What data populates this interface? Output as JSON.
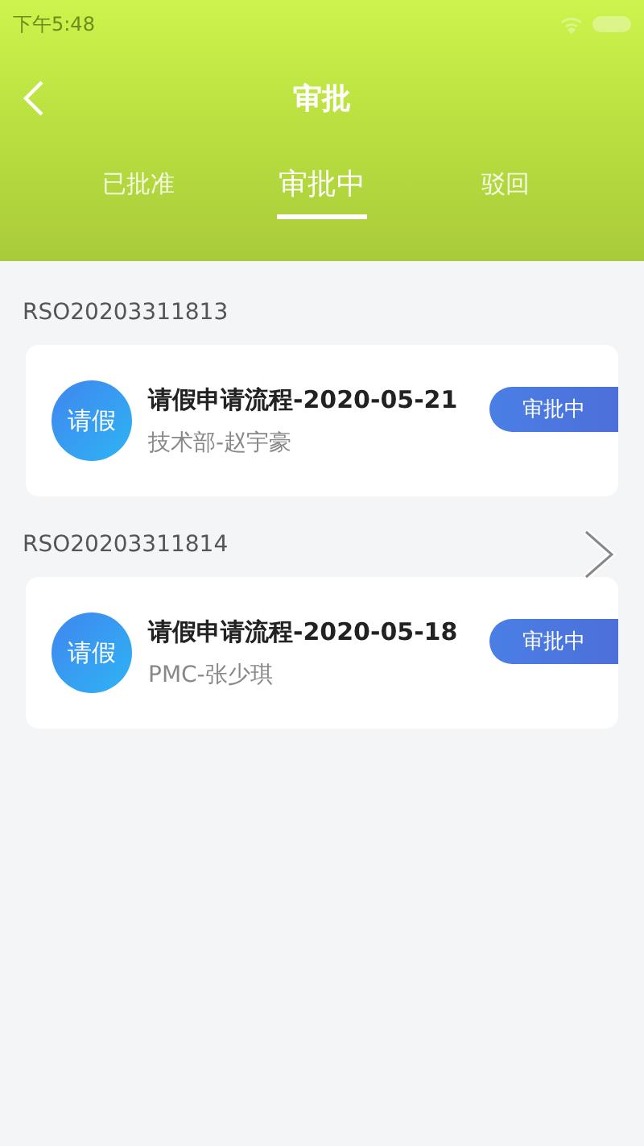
{
  "status_bar": {
    "time": "下午5:48"
  },
  "header": {
    "title": "审批"
  },
  "tabs": [
    {
      "label": "已批准",
      "selected": false
    },
    {
      "label": "审批中",
      "selected": true
    },
    {
      "label": "驳回",
      "selected": false
    }
  ],
  "groups": [
    {
      "code": "RSO20203311813",
      "avatar": "请假",
      "title": "请假申请流程-2020-05-21",
      "subtitle": "技术部-赵宇豪",
      "status": "审批中"
    },
    {
      "code": "RSO20203311814",
      "avatar": "请假",
      "title": "请假申请流程-2020-05-18",
      "subtitle": "PMC-张少琪",
      "status": "审批中"
    }
  ]
}
